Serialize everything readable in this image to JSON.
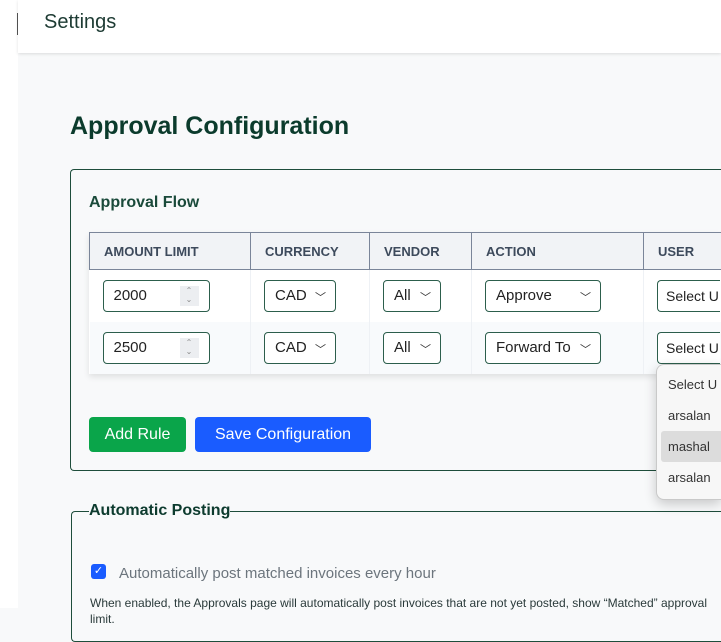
{
  "header": {
    "title": "Settings"
  },
  "page_title": "Approval Configuration",
  "approval_flow": {
    "title": "Approval Flow",
    "columns": [
      "AMOUNT LIMIT",
      "CURRENCY",
      "VENDOR",
      "ACTION",
      "USER"
    ],
    "rows": [
      {
        "amount": "2000",
        "currency": "CAD",
        "vendor": "All",
        "action": "Approve",
        "user": "Select U"
      },
      {
        "amount": "2500",
        "currency": "CAD",
        "vendor": "All",
        "action": "Forward To",
        "user": "Select U"
      }
    ],
    "add_rule": "Add Rule",
    "save": "Save Configuration",
    "user_dropdown": {
      "options": [
        "Select U",
        "arsalan",
        "mashal",
        "arsalan"
      ],
      "highlighted": "mashal"
    }
  },
  "automatic_posting": {
    "legend": "Automatic Posting",
    "checkbox_label": "Automatically post matched invoices every hour",
    "checked": true,
    "note": "When enabled, the Approvals page will automatically post invoices that are not yet posted, show “Matched” approval limit."
  },
  "colors": {
    "add_rule": "#0aa54a",
    "save": "#1a5cff",
    "heading": "#0b3b2c"
  }
}
